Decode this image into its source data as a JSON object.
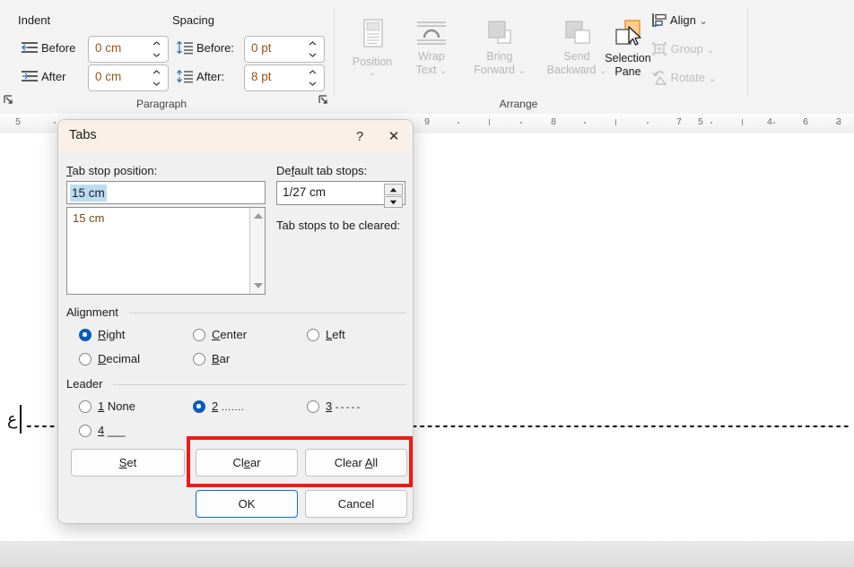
{
  "ribbon": {
    "paragraph_group": {
      "label": "Paragraph",
      "indent_header": "Indent",
      "spacing_header": "Spacing",
      "indent_before_label": "Before",
      "indent_before_value": "0 cm",
      "indent_after_label": "After",
      "indent_after_value": "0 cm",
      "spacing_before_label": "Before:",
      "spacing_before_value": "0 pt",
      "spacing_after_label": "After:",
      "spacing_after_value": "8 pt",
      "dialog_launcher": "paragraph-settings"
    },
    "arrange_group": {
      "label": "Arrange",
      "position_label": "Position",
      "wrap_text_label": "Wrap\nText",
      "wrap_text_line1": "Wrap",
      "wrap_text_line2": "Text",
      "bring_forward_line1": "Bring",
      "bring_forward_line2": "Forward",
      "send_backward_line1": "Send",
      "send_backward_line2": "Backward",
      "selection_pane_line1": "Selection",
      "selection_pane_line2": "Pane",
      "align_label": "Align",
      "group_label": "Group",
      "rotate_label": "Rotate"
    }
  },
  "ruler": {
    "left_marker": "5",
    "ticks": [
      "9",
      "8",
      "7",
      "6",
      "5",
      "4",
      "3"
    ]
  },
  "document": {
    "character": "ع",
    "leader": "dotted-leader-line"
  },
  "dialog": {
    "title": "Tabs",
    "help_glyph": "?",
    "close_glyph": "✕",
    "tab_stop_position_label": "Tab stop position:",
    "tab_stop_position_accel": "T",
    "tab_stop_position_value": "15 cm",
    "default_tab_stops_label": "Default tab stops:",
    "default_tab_stops_accel": "f",
    "default_tab_stops_value": "1/27 cm",
    "tab_stops_to_be_cleared_label": "Tab stops to be cleared:",
    "list_items": [
      "15 cm"
    ],
    "alignment": {
      "caption": "Alignment",
      "selected": "Right",
      "options": [
        {
          "label": "Right",
          "accel": "R",
          "selected": true
        },
        {
          "label": "Center",
          "accel": "C",
          "selected": false
        },
        {
          "label": "Left",
          "accel": "L",
          "selected": false
        },
        {
          "label": "Decimal",
          "accel": "D",
          "selected": false
        },
        {
          "label": "Bar",
          "accel": "B",
          "selected": false
        }
      ]
    },
    "leader": {
      "caption": "Leader",
      "selected": "2",
      "options": [
        {
          "number": "1",
          "sample": "None",
          "selected": false
        },
        {
          "number": "2",
          "sample": ".......",
          "selected": true
        },
        {
          "number": "3",
          "sample": "- - - - -",
          "selected": false
        },
        {
          "number": "4",
          "sample": "___",
          "selected": false
        }
      ]
    },
    "buttons": {
      "set": "Set",
      "set_accel": "S",
      "clear": "Clear",
      "clear_accel": "e",
      "clear_all": "Clear All",
      "clear_all_accel": "A",
      "ok": "OK",
      "cancel": "Cancel"
    }
  },
  "annotation": {
    "highlight_color": "#ee1b16",
    "highlight_target": "clear-and-clear-all-buttons"
  }
}
